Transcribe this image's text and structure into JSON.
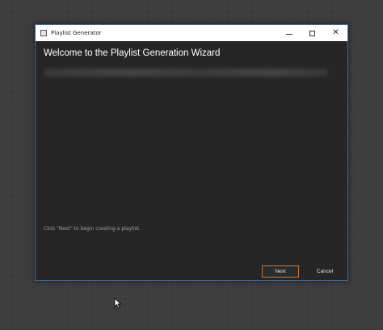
{
  "window": {
    "title": "Playlist Generator",
    "controls": {
      "minimize": "minimize",
      "maximize": "maximize",
      "close": "✕"
    }
  },
  "wizard": {
    "heading": "Welcome to the Playlist Generation Wizard",
    "hint": "Click \"Next\" to begin creating a playlist.",
    "next_label": "Next",
    "cancel_label": "Cancel"
  },
  "colors": {
    "window_bg": "#262626",
    "accent_border": "#2f6fb8",
    "next_border": "#c07a44"
  }
}
